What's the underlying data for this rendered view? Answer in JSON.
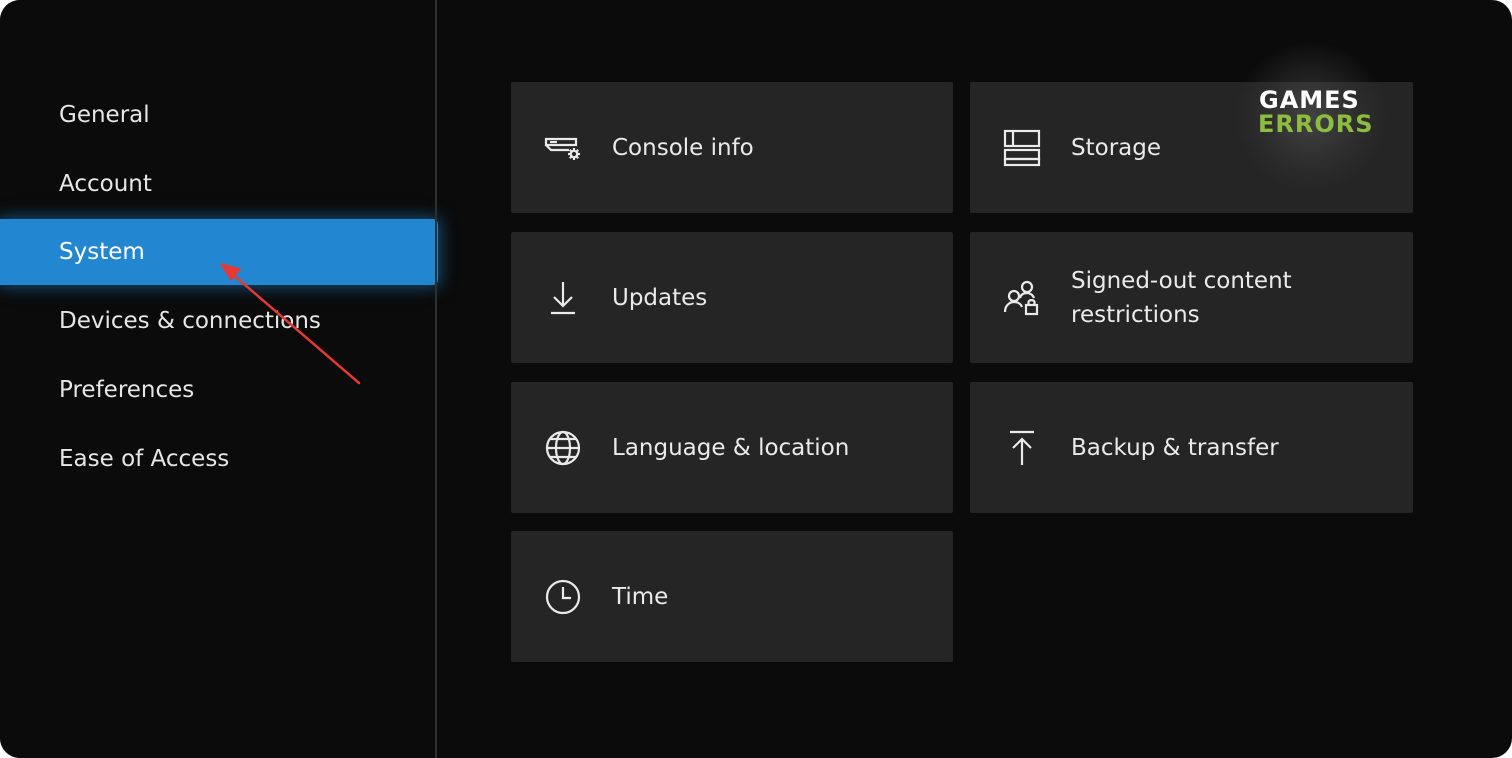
{
  "sidebar": {
    "items": [
      {
        "label": "General"
      },
      {
        "label": "Account"
      },
      {
        "label": "System",
        "selected": true
      },
      {
        "label": "Devices & connections"
      },
      {
        "label": "Preferences"
      },
      {
        "label": "Ease of Access"
      }
    ]
  },
  "tiles": [
    {
      "label": "Console info",
      "icon": "console-info-icon"
    },
    {
      "label": "Storage",
      "icon": "storage-icon"
    },
    {
      "label": "Updates",
      "icon": "download-arrow-icon"
    },
    {
      "label": "Signed-out content restrictions",
      "icon": "people-lock-icon"
    },
    {
      "label": "Language & location",
      "icon": "globe-icon"
    },
    {
      "label": "Backup & transfer",
      "icon": "upload-arrow-icon"
    },
    {
      "label": "Time",
      "icon": "clock-icon"
    }
  ],
  "watermark": {
    "line1": "GAMES",
    "line2": "ERRORS",
    "line2_color": "#8cbd3f"
  },
  "colors": {
    "background": "#0b0b0b",
    "tile": "#252525",
    "accent": "#2386d1",
    "annotation_arrow": "#e53935"
  }
}
